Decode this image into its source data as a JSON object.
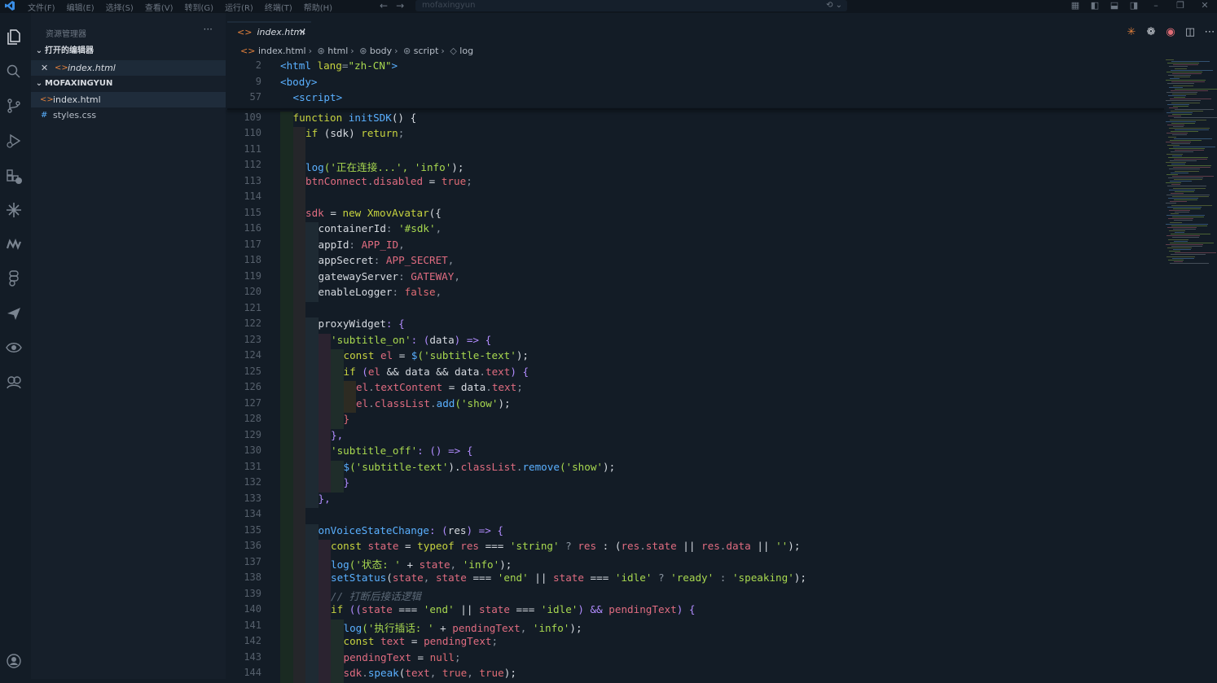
{
  "menu": [
    "文件(F)",
    "编辑(E)",
    "选择(S)",
    "查看(V)",
    "转到(G)",
    "运行(R)",
    "终端(T)",
    "帮助(H)"
  ],
  "command_center": {
    "placeholder": "mofaxingyun"
  },
  "sidebar": {
    "title": "资源管理器",
    "open_editors_label": "打开的编辑器",
    "open_editor_file": "index.html",
    "folder_label": "MOFAXINGYUN",
    "files": [
      {
        "name": "index.html",
        "icon": "<>"
      },
      {
        "name": "styles.css",
        "icon": "#"
      }
    ]
  },
  "tab": {
    "label": "index.html"
  },
  "breadcrumb": [
    "index.html",
    "html",
    "body",
    "script",
    "log"
  ],
  "sticky_lines": [
    {
      "n": "2",
      "indent": 0
    },
    {
      "n": "9",
      "indent": 0
    },
    {
      "n": "57",
      "indent": 1
    }
  ],
  "code_lines": [
    {
      "n": "109"
    },
    {
      "n": "110"
    },
    {
      "n": "111"
    },
    {
      "n": "112"
    },
    {
      "n": "113"
    },
    {
      "n": "114"
    },
    {
      "n": "115"
    },
    {
      "n": "116"
    },
    {
      "n": "117"
    },
    {
      "n": "118"
    },
    {
      "n": "119"
    },
    {
      "n": "120"
    },
    {
      "n": "121"
    },
    {
      "n": "122"
    },
    {
      "n": "123"
    },
    {
      "n": "124"
    },
    {
      "n": "125"
    },
    {
      "n": "126"
    },
    {
      "n": "127"
    },
    {
      "n": "128"
    },
    {
      "n": "129"
    },
    {
      "n": "130"
    },
    {
      "n": "131"
    },
    {
      "n": "132"
    },
    {
      "n": "133"
    },
    {
      "n": "134"
    },
    {
      "n": "135"
    },
    {
      "n": "136"
    },
    {
      "n": "137"
    },
    {
      "n": "138"
    },
    {
      "n": "139"
    },
    {
      "n": "140"
    },
    {
      "n": "141"
    },
    {
      "n": "142"
    },
    {
      "n": "143"
    },
    {
      "n": "144"
    }
  ],
  "code_text": {
    "s2": [
      "<html lang=\"zh-CN\">"
    ],
    "s9": "<body>",
    "s57": "<script>",
    "l109": [
      "function ",
      "initSDK",
      "() {"
    ],
    "l110": [
      "if ",
      "(sdk) ",
      "return",
      ";"
    ],
    "l112": [
      "log",
      "('正在连接...', ",
      "'info'",
      ");"
    ],
    "l113": [
      "btnConnect",
      ".",
      "disabled",
      " = ",
      "true",
      ";"
    ],
    "l115": [
      "sdk",
      " = ",
      "new ",
      "XmovAvatar",
      "({"
    ],
    "l116": [
      "containerId",
      ": ",
      "'#sdk'",
      ","
    ],
    "l117": [
      "appId",
      ": ",
      "APP_ID",
      ","
    ],
    "l118": [
      "appSecret",
      ": ",
      "APP_SECRET",
      ","
    ],
    "l119": [
      "gatewayServer",
      ": ",
      "GATEWAY",
      ","
    ],
    "l120": [
      "enableLogger",
      ": ",
      "false",
      ","
    ],
    "l122": [
      "proxyWidget",
      ": {"
    ],
    "l123": [
      "'subtitle_on'",
      ": (",
      "data",
      ") => {"
    ],
    "l124": [
      "const ",
      "el",
      " = ",
      "$",
      "('subtitle-text'",
      ");"
    ],
    "l125": [
      "if ",
      "(",
      "el",
      " && ",
      "data",
      " && ",
      "data",
      ".",
      "text",
      ") {"
    ],
    "l126": [
      "el",
      ".",
      "textContent",
      " = ",
      "data",
      ".",
      "text",
      ";"
    ],
    "l127": [
      "el",
      ".",
      "classList",
      ".",
      "add",
      "('show'",
      ");"
    ],
    "l128": [
      "}"
    ],
    "l129": [
      "},"
    ],
    "l130": [
      "'subtitle_off'",
      ": () => {"
    ],
    "l131": [
      "$",
      "('subtitle-text'",
      ").",
      "classList",
      ".",
      "remove",
      "('show'",
      ");"
    ],
    "l132": [
      "}"
    ],
    "l133": [
      "},"
    ],
    "l135": [
      "onVoiceStateChange",
      ": (",
      "res",
      ") => {"
    ],
    "l136": [
      "const ",
      "state",
      " = ",
      "typeof ",
      "res",
      " === ",
      "'string'",
      " ? ",
      "res",
      " : (",
      "res",
      ".",
      "state",
      " || ",
      "res",
      ".",
      "data",
      " || ",
      "''",
      "); "
    ],
    "l137": [
      "log",
      "('状态: '",
      " + ",
      "state",
      ", ",
      "'info'",
      ");"
    ],
    "l138": [
      "setStatus",
      "(",
      "state",
      ", ",
      "state",
      " === ",
      "'end'",
      " || ",
      "state",
      " === ",
      "'idle'",
      " ? ",
      "'ready'",
      " : ",
      "'speaking'",
      ");"
    ],
    "l139": [
      "// 打断后接话逻辑"
    ],
    "l140": [
      "if ",
      "((",
      "state",
      " === ",
      "'end'",
      " || ",
      "state",
      " === ",
      "'idle'",
      ") && ",
      "pendingText",
      ") {"
    ],
    "l141": [
      "log",
      "('执行插话: '",
      " + ",
      "pendingText",
      ", ",
      "'info'",
      ");"
    ],
    "l142": [
      "const ",
      "text",
      " = ",
      "pendingText",
      ";"
    ],
    "l143": [
      "pendingText",
      " = ",
      "null",
      ";"
    ],
    "l144": [
      "sdk",
      ".",
      "speak",
      "(",
      "text",
      ", ",
      "true",
      ", ",
      "true",
      ");"
    ]
  },
  "colors": {
    "background": "#131c26",
    "sidebar": "#161f2a",
    "accent_orange": "#e3813c",
    "keyword": "#c7d33f",
    "string": "#a8d84f",
    "function": "#5ab0ff"
  }
}
